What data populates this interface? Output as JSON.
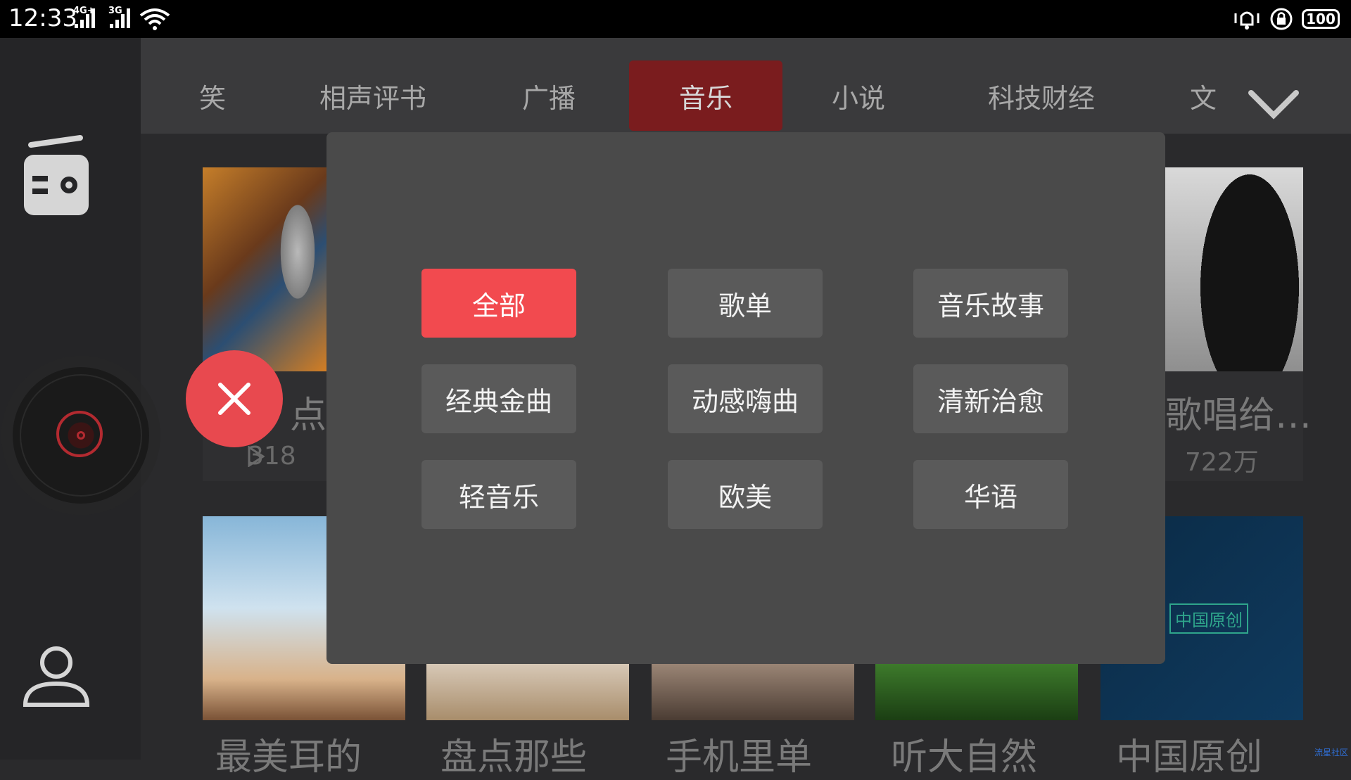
{
  "status_bar": {
    "time": "12:33",
    "signal1_label": "4G+",
    "signal2_label": "3G",
    "battery": "100"
  },
  "tabs": [
    {
      "label": "笑"
    },
    {
      "label": "相声评书"
    },
    {
      "label": "广播"
    },
    {
      "label": "音乐",
      "active": true
    },
    {
      "label": "小说"
    },
    {
      "label": "科技财经"
    },
    {
      "label": "文"
    }
  ],
  "cards": {
    "row1_left": {
      "title": "点",
      "count": "318"
    },
    "row1_right": {
      "title": "歌唱给…",
      "count": "722万"
    },
    "row2": [
      {
        "title": "最美耳的"
      },
      {
        "title": "盘点那些"
      },
      {
        "title": "手机里单"
      },
      {
        "title": "听大自然"
      },
      {
        "title": "中国原创"
      }
    ],
    "china_badge": "中国原创"
  },
  "modal": {
    "categories": [
      {
        "label": "全部",
        "selected": true
      },
      {
        "label": "歌单"
      },
      {
        "label": "音乐故事"
      },
      {
        "label": "经典金曲"
      },
      {
        "label": "动感嗨曲"
      },
      {
        "label": "清新治愈"
      },
      {
        "label": "轻音乐"
      },
      {
        "label": "欧美"
      },
      {
        "label": "华语"
      }
    ]
  },
  "colors": {
    "accent": "#f24a4f",
    "active_tab": "#7a1c1e"
  },
  "watermark": "流星社区"
}
